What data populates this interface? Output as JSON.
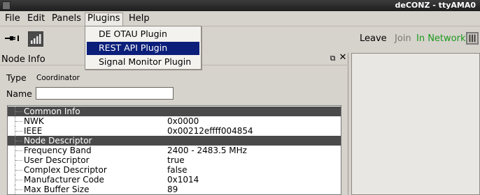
{
  "window": {
    "title": "deCONZ - ttyAMA0"
  },
  "menubar": {
    "file": "File",
    "edit": "Edit",
    "panels": "Panels",
    "plugins": "Plugins",
    "help": "Help"
  },
  "plugins_menu": {
    "items": [
      "DE OTAU Plugin",
      "REST API Plugin",
      "Signal Monitor Plugin"
    ],
    "selected_index": 1
  },
  "toolbar": {
    "leave": "Leave",
    "join": "Join",
    "in_network": "In Network"
  },
  "node_info": {
    "title": "Node Info",
    "float_icon": "⧉",
    "close_icon": "✕",
    "type_label": "Type",
    "type_value": "Coordinator",
    "name_label": "Name",
    "name_value": "",
    "rows": [
      {
        "section": "Common Info"
      },
      {
        "key": "NWK",
        "value": "0x0000"
      },
      {
        "key": "IEEE",
        "value": "0x00212effff004854"
      },
      {
        "section": "Node Descriptor"
      },
      {
        "key": "Frequency Band",
        "value": "2400 - 2483.5 MHz"
      },
      {
        "key": "User Descriptor",
        "value": "true"
      },
      {
        "key": "Complex Descriptor",
        "value": "false"
      },
      {
        "key": "Manufacturer Code",
        "value": "0x1014"
      },
      {
        "key": "Max Buffer Size",
        "value": "89"
      }
    ]
  },
  "colors": {
    "accent_selected": "#0b1f7a",
    "in_network": "#1d9a1d",
    "section_bg": "#4a4a4a"
  }
}
